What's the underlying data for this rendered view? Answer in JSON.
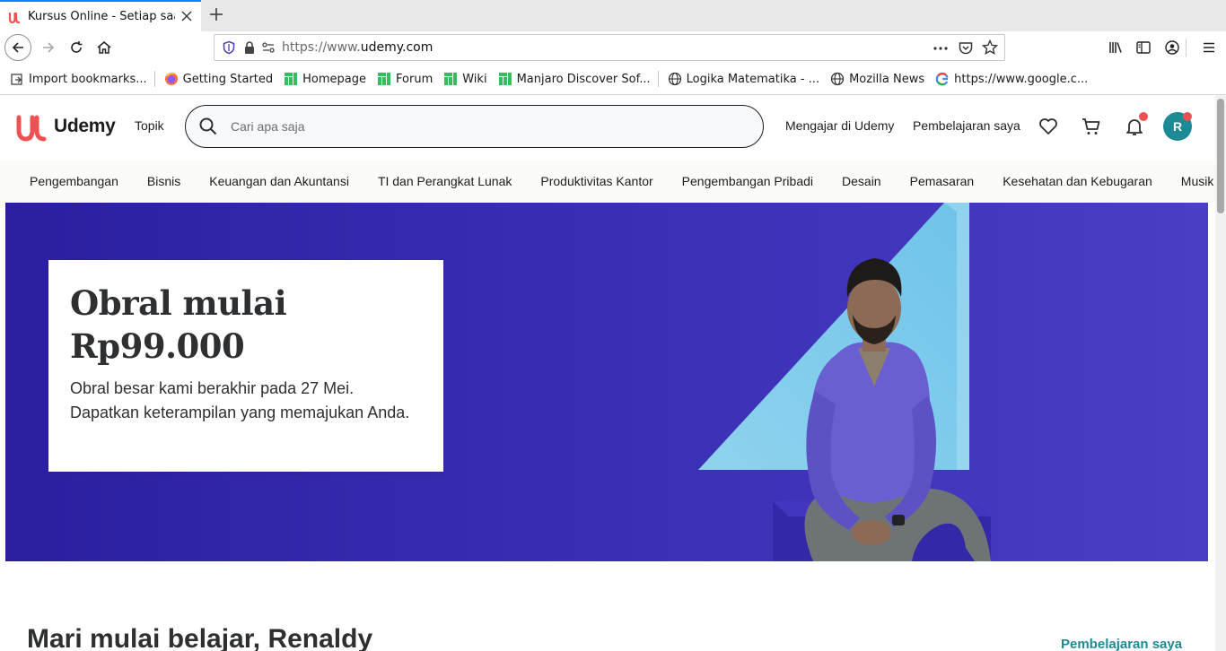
{
  "browser": {
    "tab": {
      "title": "Kursus Online - Setiap saat"
    },
    "url": {
      "scheme": "https://www.",
      "host": "udemy.com"
    },
    "bookmarks": [
      {
        "label": "Import bookmarks...",
        "icon": "import-icon"
      },
      {
        "label": "Getting Started",
        "icon": "firefox-icon"
      },
      {
        "label": "Homepage",
        "icon": "manjaro-icon"
      },
      {
        "label": "Forum",
        "icon": "manjaro-icon"
      },
      {
        "label": "Wiki",
        "icon": "manjaro-icon"
      },
      {
        "label": "Manjaro Discover Sof...",
        "icon": "manjaro-icon"
      },
      {
        "label": "Logika Matematika - ...",
        "icon": "globe-icon"
      },
      {
        "label": "Mozilla News",
        "icon": "globe-icon"
      },
      {
        "label": "https://www.google.c...",
        "icon": "google-icon"
      }
    ]
  },
  "header": {
    "logo": "Udemy",
    "topics": "Topik",
    "search_placeholder": "Cari apa saja",
    "teach": "Mengajar di Udemy",
    "my_learning": "Pembelajaran saya",
    "avatar_initial": "R"
  },
  "categories": [
    "Pengembangan",
    "Bisnis",
    "Keuangan dan Akuntansi",
    "TI dan Perangkat Lunak",
    "Produktivitas Kantor",
    "Pengembangan Pribadi",
    "Desain",
    "Pemasaran",
    "Kesehatan dan Kebugaran",
    "Musik"
  ],
  "hero": {
    "title_line1": "Obral mulai",
    "title_line2": "Rp99.000",
    "text": "Obral besar kami berakhir pada 27 Mei. Dapatkan keterampilan yang memajukan Anda."
  },
  "main": {
    "greeting": "Mari mulai belajar, Renaldy",
    "my_learning_link": "Pembelajaran saya"
  },
  "colors": {
    "brand_red": "#ec5252",
    "hero_bg": "#3e30b3",
    "teal": "#1e8a95"
  }
}
